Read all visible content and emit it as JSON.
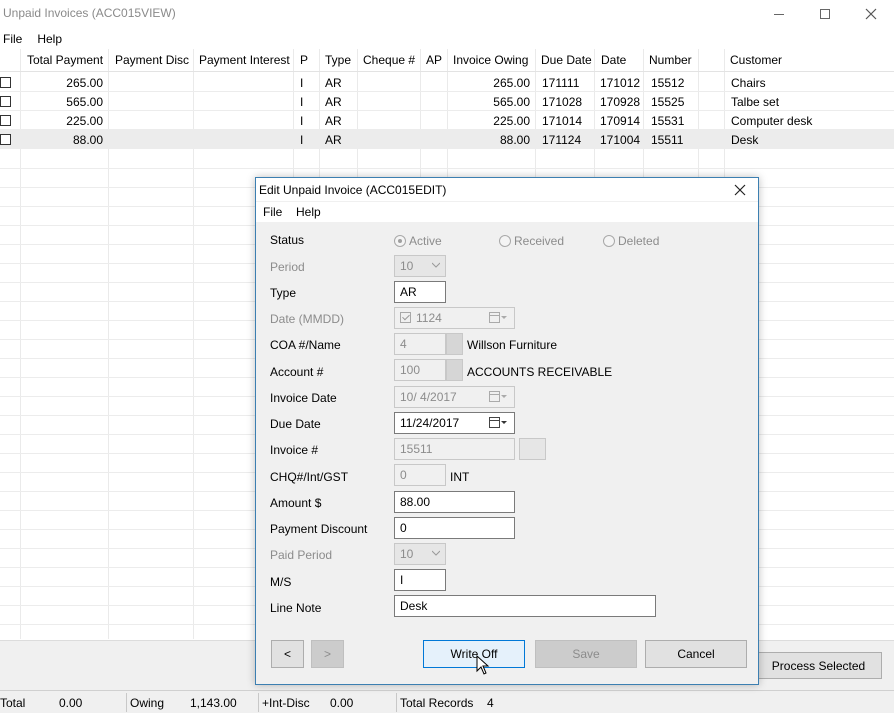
{
  "window": {
    "title": "Unpaid Invoices (ACC015VIEW)"
  },
  "menu": {
    "file": "File",
    "help": "Help"
  },
  "grid": {
    "headers": {
      "total_payment": "Total Payment",
      "payment_disc": "Payment Disc",
      "payment_interest": "Payment Interest",
      "p": "P",
      "type": "Type",
      "cheque": "Cheque #",
      "ap": "AP",
      "invoice_owing": "Invoice Owing",
      "due_date": "Due Date",
      "date": "Date",
      "number": "Number",
      "customer": "Customer"
    },
    "rows": [
      {
        "total_payment": "265.00",
        "p": "I",
        "type": "AR",
        "invoice_owing": "265.00",
        "due_date": "171111",
        "date": "171012",
        "number": "15512",
        "customer": "Chairs"
      },
      {
        "total_payment": "565.00",
        "p": "I",
        "type": "AR",
        "invoice_owing": "565.00",
        "due_date": "171028",
        "date": "170928",
        "number": "15525",
        "customer": "Talbe set"
      },
      {
        "total_payment": "225.00",
        "p": "I",
        "type": "AR",
        "invoice_owing": "225.00",
        "due_date": "171014",
        "date": "170914",
        "number": "15531",
        "customer": "Computer desk"
      },
      {
        "total_payment": "88.00",
        "p": "I",
        "type": "AR",
        "invoice_owing": "88.00",
        "due_date": "171124",
        "date": "171004",
        "number": "15511",
        "customer": "Desk"
      }
    ]
  },
  "process_button": "Process Selected",
  "status": {
    "total_label": "Total",
    "total_value": "0.00",
    "owing_label": "Owing",
    "owing_value": "1,143.00",
    "int_disc_label": "+Int-Disc",
    "int_disc_value": "0.00",
    "records_label": "Total Records",
    "records_value": "4"
  },
  "dialog": {
    "title": "Edit Unpaid Invoice (ACC015EDIT)",
    "menu": {
      "file": "File",
      "help": "Help"
    },
    "labels": {
      "status": "Status",
      "period": "Period",
      "type": "Type",
      "date": "Date (MMDD)",
      "coa": "COA #/Name",
      "account": "Account #",
      "invoice_date": "Invoice Date",
      "due_date": "Due Date",
      "invoice_no": "Invoice #",
      "chq": "CHQ#/Int/GST",
      "amount": "Amount $",
      "payment_discount": "Payment Discount",
      "paid_period": "Paid Period",
      "ms": "M/S",
      "line_note": "Line Note"
    },
    "status_options": [
      "Active",
      "Received",
      "Deleted"
    ],
    "status_selected": "Active",
    "values": {
      "period": "10",
      "type": "AR",
      "date": "1124",
      "coa_no": "4",
      "coa_name": "Willson Furniture",
      "account_no": "100",
      "account_name": "ACCOUNTS RECEIVABLE",
      "invoice_date": "10/ 4/2017",
      "due_date": "11/24/2017",
      "invoice_no": "15511",
      "chq": "0",
      "chq_suffix": "INT",
      "amount": "88.00",
      "payment_discount": "0",
      "paid_period": "10",
      "ms": "I",
      "line_note": "Desk"
    },
    "buttons": {
      "prev": "<",
      "next": ">",
      "write_off": "Write Off",
      "save": "Save",
      "cancel": "Cancel"
    }
  }
}
